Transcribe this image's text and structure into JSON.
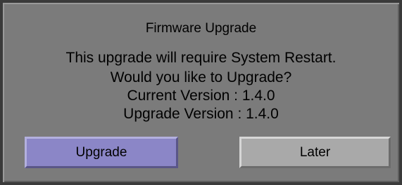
{
  "dialog": {
    "title": "Firmware Upgrade",
    "message_line_1": "This upgrade will require System Restart.",
    "message_line_2": "Would you like to Upgrade?",
    "current_version": "Current Version : 1.4.0",
    "upgrade_version": "Upgrade Version : 1.4.0"
  },
  "buttons": {
    "upgrade_label": "Upgrade",
    "later_label": "Later"
  },
  "colors": {
    "dialog_background": "#7b7b7b",
    "upgrade_button": "#8b86c7",
    "later_button": "#a9a9a9"
  }
}
